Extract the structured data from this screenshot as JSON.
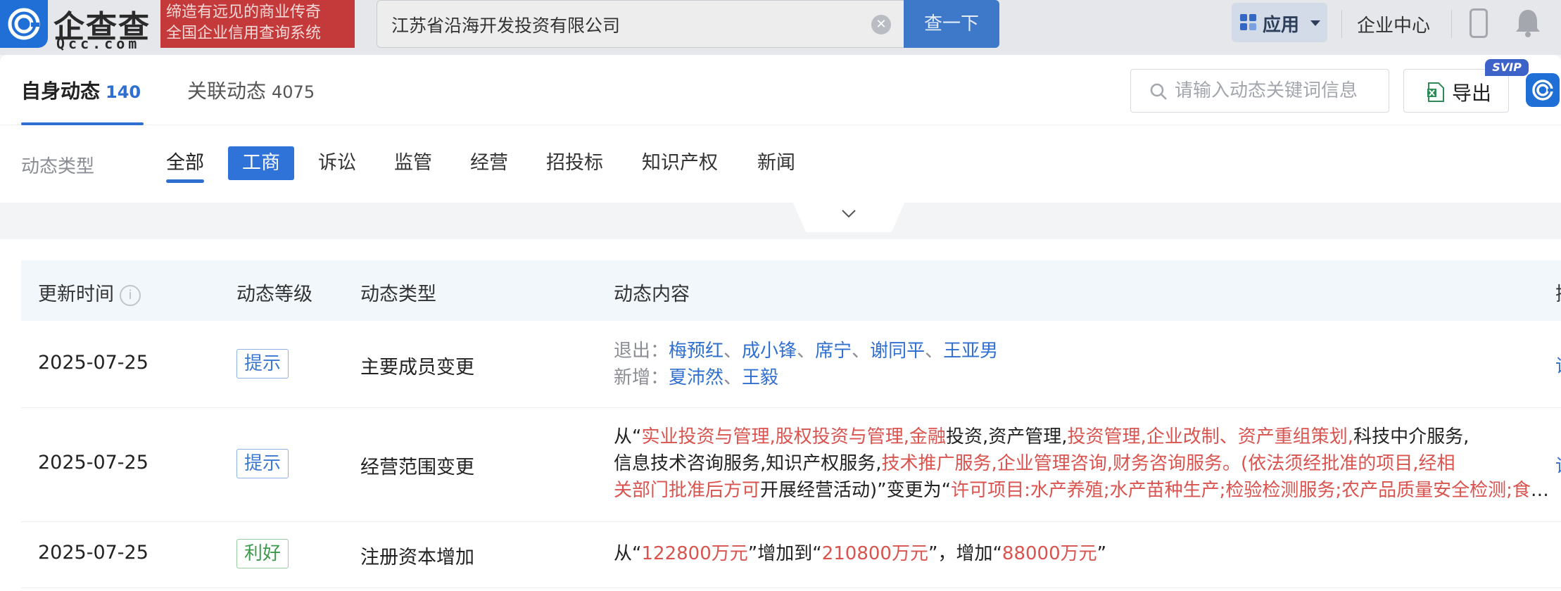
{
  "header": {
    "logo_text": "企查查",
    "logo_sub": "Qcc.com",
    "slogan_line1": "缔造有远见的商业传奇",
    "slogan_line2": "全国企业信用查询系统",
    "search_value": "江苏省沿海开发投资有限公司",
    "search_button": "查一下",
    "app_button": "应用",
    "enterprise_center": "企业中心"
  },
  "tabs": {
    "self_label": "自身动态",
    "self_count": "140",
    "related_label": "关联动态",
    "related_count": "4075",
    "keyword_placeholder": "请输入动态关键词信息",
    "export_label": "导出",
    "svip": "SVIP"
  },
  "filter": {
    "label": "动态类型",
    "items": [
      "全部",
      "工商",
      "诉讼",
      "监管",
      "经营",
      "招投标",
      "知识产权",
      "新闻"
    ]
  },
  "table": {
    "headers": [
      "更新时间",
      "动态等级",
      "动态类型",
      "动态内容",
      "操"
    ],
    "info_icon": "i",
    "edge_link": "详",
    "rows": [
      {
        "date": "2025-07-25",
        "level": "提示",
        "type": "主要成员变更",
        "exit_label": "退出：",
        "exit_names": [
          "梅预红",
          "成小锋",
          "席宁",
          "谢同平",
          "王亚男"
        ],
        "add_label": "新增：",
        "add_names": [
          "夏沛然",
          "王毅"
        ],
        "name_sep": "、"
      },
      {
        "date": "2025-07-25",
        "level": "提示",
        "type": "经营范围变更",
        "l1_a": "从“",
        "l1_b": "实业投资与管理,股权投资与管理,金融",
        "l1_c": "投资,资产管理,",
        "l1_d": "投资管理,企业改制、资产重组策划,",
        "l1_e": "科技中介服务,",
        "l2_a": "信息技术咨询服务,知识产权服务,",
        "l2_b": "技术推广服务,企业管理咨询,财务咨询服务。(依法须经批准的项目,经相",
        "l3_a": "关部门批准后方可",
        "l3_b": "开展经营活动)”变更为“",
        "l3_c": "许可项目:水产养殖;水产苗种生产;检验检测服务;农产品质量安全检测;食品生产"
      },
      {
        "date": "2025-07-25",
        "level": "利好",
        "type": "注册资本增加",
        "p1": "从“",
        "v1": "122800万元",
        "p2": "”增加到“",
        "v2": "210800万元",
        "p3": "”，增加“",
        "v3": "88000万元",
        "p4": "”"
      }
    ]
  }
}
